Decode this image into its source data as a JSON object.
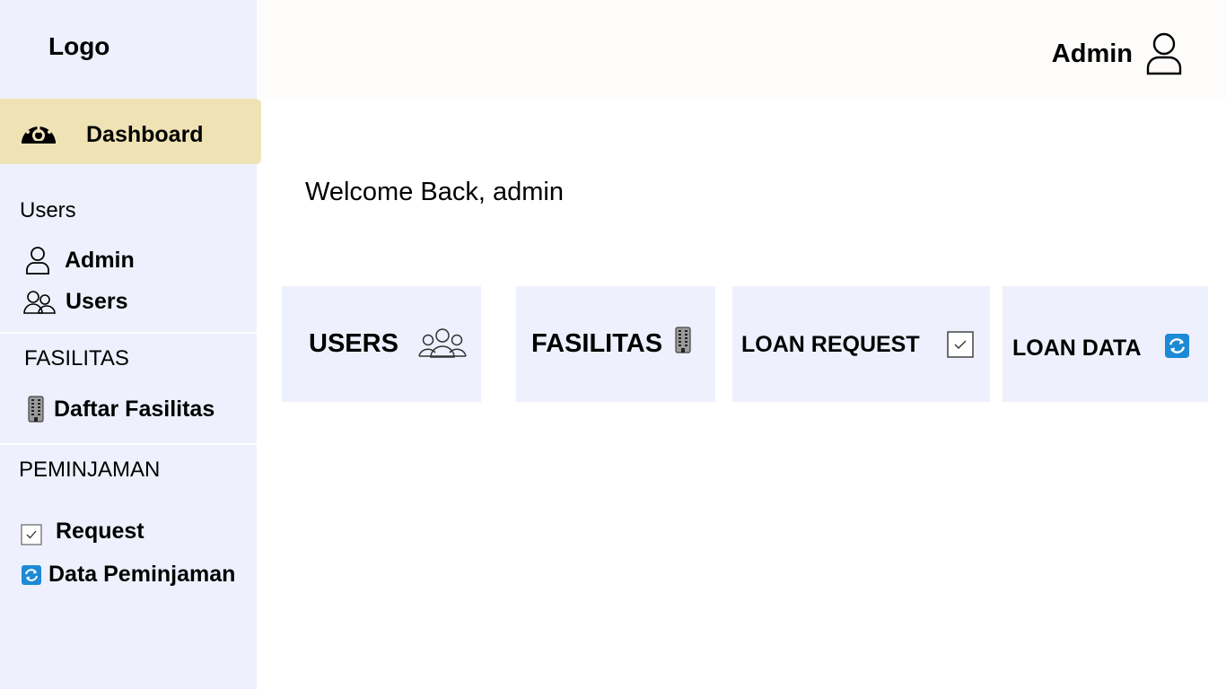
{
  "sidebar": {
    "logo": "Logo",
    "dashboard": "Dashboard",
    "sections": {
      "users": "Users",
      "fasilitas": "FASILITAS",
      "peminjaman": "PEMINJAMAN"
    },
    "items": {
      "admin": "Admin",
      "users": "Users",
      "daftar_fasilitas": "Daftar Fasilitas",
      "request": "Request",
      "data_peminjaman": "Data Peminjaman"
    }
  },
  "header": {
    "user_name": "Admin"
  },
  "main": {
    "welcome": "Welcome Back, admin",
    "cards": {
      "users": "USERS",
      "fasilitas": "FASILITAS",
      "loan_request": "LOAN REQUEST",
      "loan_data": "LOAN DATA"
    }
  },
  "icons": {
    "dashboard": "dashboard-gauge-icon",
    "user": "user-icon",
    "users": "users-group-icon",
    "building": "building-icon",
    "check": "checkbox-icon",
    "refresh": "refresh-icon"
  },
  "colors": {
    "sidebar_bg": "#eef1fd",
    "active_bg": "#efe3b6",
    "card_bg": "#eef1fd",
    "header_bg": "#fdfcfa",
    "refresh_blue": "#1d8ad6"
  }
}
